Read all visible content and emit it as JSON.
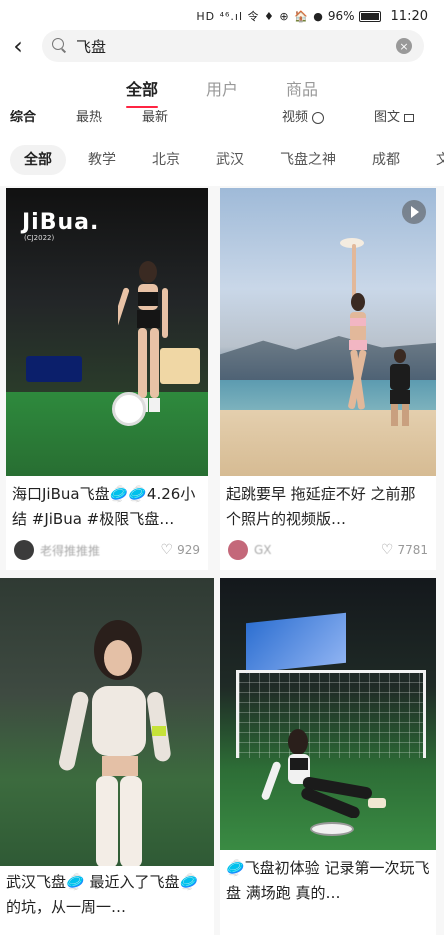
{
  "status_bar": {
    "icons": "HD ⁴⁶.ıl 令 ♦ ⊕ 🏠 ●",
    "battery": "96%",
    "time": "11:20"
  },
  "search": {
    "query": "飞盘",
    "clear_icon": "×"
  },
  "main_tabs": [
    {
      "label": "全部",
      "active": true
    },
    {
      "label": "用户",
      "active": false
    },
    {
      "label": "商品",
      "active": false
    }
  ],
  "sort_bar": {
    "items": [
      "综合",
      "最热",
      "最新",
      "视频",
      "图文"
    ]
  },
  "chips": [
    {
      "label": "全部",
      "active": true
    },
    {
      "label": "教学",
      "active": false
    },
    {
      "label": "北京",
      "active": false
    },
    {
      "label": "武汉",
      "active": false
    },
    {
      "label": "飞盘之神",
      "active": false
    },
    {
      "label": "成都",
      "active": false
    },
    {
      "label": "文案",
      "active": false
    }
  ],
  "cards": [
    {
      "image_text": "JiBua.",
      "image_subtext": "(CJ2022)",
      "title": "海口JiBua飞盘🥏🥏4.26小结 #JiBua #极限飞盘…",
      "author": "老得推推推",
      "likes": "929",
      "avatar_color": "#3b3b3b",
      "is_video": false
    },
    {
      "title": "起跳要早 拖延症不好 之前那个照片的视频版…",
      "author": "GX",
      "likes": "7781",
      "avatar_color": "#c4687a",
      "is_video": true
    },
    {
      "title": "武汉飞盘🥏 最近入了飞盘🥏的坑，从一周一…",
      "is_video": false
    },
    {
      "title": "🥏飞盘初体验 记录第一次玩飞盘 满场跑 真的…",
      "is_video": false
    }
  ],
  "colors": {
    "accent": "#ff2442",
    "heart": "#999999"
  }
}
